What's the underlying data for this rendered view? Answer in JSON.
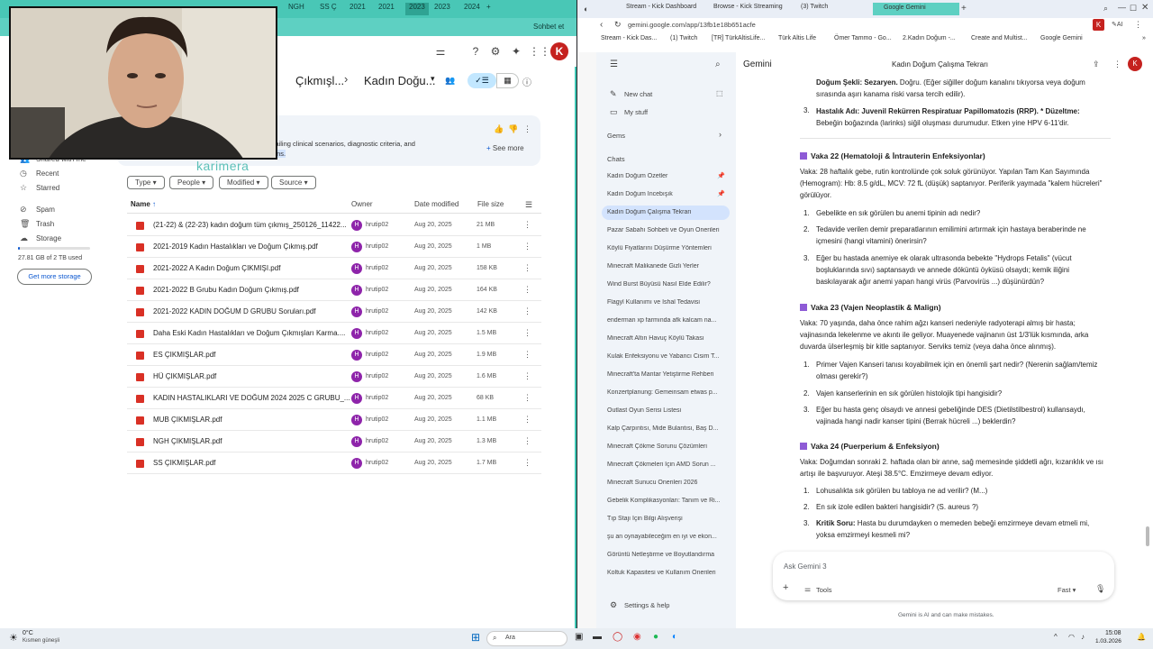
{
  "left_tabs": [
    "NGH",
    "SS Ç",
    "2021",
    "2021",
    "2023",
    "2023",
    "2024"
  ],
  "left_tab_extra": "Sohbet et",
  "drive": {
    "breadcrumb_1": "Çıkmışl...",
    "breadcrumb_2": "Kadın Doğu...",
    "brand_overlay": "karimera",
    "ai_summary_line1": "ns detailing clinical scenarios, diagnostic criteria, and",
    "ai_summary_line2": "onditions.",
    "see_more": "See more",
    "sidebar": {
      "shared": "Shared with me",
      "recent": "Recent",
      "starred": "Starred",
      "spam": "Spam",
      "trash": "Trash",
      "storage": "Storage",
      "storage_used": "27.81 GB of 2 TB used",
      "get_more": "Get more storage"
    },
    "filters": [
      "Type",
      "People",
      "Modified",
      "Source"
    ],
    "columns": {
      "name": "Name",
      "owner": "Owner",
      "date": "Date modified",
      "size": "File size"
    },
    "files": [
      {
        "name": "(21-22) & (22-23) kadın doğum tüm çıkmış_250126_11422...",
        "owner": "hrutip02",
        "date": "Aug 20, 2025",
        "size": "21 MB"
      },
      {
        "name": "2021-2019 Kadın Hastalıkları ve Doğum Çıkmış.pdf",
        "owner": "hrutip02",
        "date": "Aug 20, 2025",
        "size": "1 MB"
      },
      {
        "name": "2021-2022 A Kadın Doğum ÇIKMIŞI.pdf",
        "owner": "hrutip02",
        "date": "Aug 20, 2025",
        "size": "158 KB"
      },
      {
        "name": "2021-2022 B Grubu Kadın Doğum Çıkmış.pdf",
        "owner": "hrutip02",
        "date": "Aug 20, 2025",
        "size": "164 KB"
      },
      {
        "name": "2021-2022 KADIN DOĞUM D GRUBU Soruları.pdf",
        "owner": "hrutip02",
        "date": "Aug 20, 2025",
        "size": "142 KB"
      },
      {
        "name": "Daha Eski Kadın Hastalıkları ve Doğum Çıkmışları Karma....",
        "owner": "hrutip02",
        "date": "Aug 20, 2025",
        "size": "1.5 MB"
      },
      {
        "name": "ES ÇIKMIŞLAR.pdf",
        "owner": "hrutip02",
        "date": "Aug 20, 2025",
        "size": "1.9 MB"
      },
      {
        "name": "HÜ ÇIKMIŞLAR.pdf",
        "owner": "hrutip02",
        "date": "Aug 20, 2025",
        "size": "1.6 MB"
      },
      {
        "name": "KADIN HASTALIKLARI VE DOĞUM 2024 2025 C GRUBU_...",
        "owner": "hrutip02",
        "date": "Aug 20, 2025",
        "size": "68 KB"
      },
      {
        "name": "MUB ÇIKMIŞLAR.pdf",
        "owner": "hrutip02",
        "date": "Aug 20, 2025",
        "size": "1.1 MB"
      },
      {
        "name": "NGH ÇIKMIŞLAR.pdf",
        "owner": "hrutip02",
        "date": "Aug 20, 2025",
        "size": "1.3 MB"
      },
      {
        "name": "SS ÇIKMIŞLAR.pdf",
        "owner": "hrutip02",
        "date": "Aug 20, 2025",
        "size": "1.7 MB"
      }
    ]
  },
  "right_tabs": [
    "Stream - Kick Dashboard",
    "Browse - Kick Streaming",
    "(3) Twitch",
    "Google Gemini"
  ],
  "url": "gemini.google.com/app/13fb1e18b651acfe",
  "bookmarks": [
    "Stream - Kick Das...",
    "(1) Twitch",
    "[TR] TürkAltisLife...",
    "Türk Altis Life",
    "Ömer Tammo - Go...",
    "2.Kadın Doğum -...",
    "Create and Multist...",
    "Google Gemini"
  ],
  "gemini": {
    "brand": "Gemini",
    "chat_title": "Kadın Doğum Çalışma Tekrarı",
    "new_chat": "New chat",
    "my_stuff": "My stuff",
    "gems": "Gems",
    "chats_label": "Chats",
    "chats": [
      "Kadın Doğum Özetler",
      "Kadın Doğum İncebışık",
      "Kadın Doğum Çalışma Tekrarı",
      "Pazar Sabahı Sohbeti ve Oyun Önerileri",
      "Köylü Fiyatlarını Düşürme Yöntemleri",
      "Minecraft Malikanede Gizli Yerler",
      "Wind Burst Büyüsü Nasıl Elde Edilir?",
      "Flagyl Kullanımı ve İshal Tedavisi",
      "enderman xp farmında afk kalcam na...",
      "Minecraft Altın Havuç Köylü Takası",
      "Kulak Enfeksiyonu ve Yabancı Cisim T...",
      "Minecraft'ta Mantar Yetiştirme Rehberi",
      "Konzertplanung: Gemeinsam etwas p...",
      "Outlast Oyun Serisi Listesi",
      "Kalp Çarpıntısı, Mide Bulantısı, Baş D...",
      "Minecraft Çökme Sorunu Çözümleri",
      "Minecraft Çökmeleri İçin AMD Sorun ...",
      "Minecraft Sunucu Önerileri 2026",
      "Gebelik Komplikasyonları: Tanım ve Ri...",
      "Tıp Stajı İçin Bilgi Alışverişi",
      "şu an oynayabileceğim en iyi ve ekon...",
      "Görüntü Netleştirme ve Boyutlandırma",
      "Koltuk Kapasitesi ve Kullanım Önerileri"
    ],
    "settings": "Settings & help",
    "input_placeholder": "Ask Gemini 3",
    "tools": "Tools",
    "mode": "Fast",
    "disclaimer": "Gemini is AI and can make mistakes.",
    "texts": {
      "top1a": "Doğum Şekli: Sezaryen.",
      "top1b": " Doğru. (Eğer siğiller doğum kanalını tıkıyorsa veya doğum sırasında aşırı kanama riski varsa tercih edilir).",
      "top2n": "3.",
      "top2a": "Hastalık Adı: Juvenil Rekürren Respiratuar Papillomatozis (RRP). * Düzeltme:",
      "top2b": "Bebeğin boğazında (larinks) siğil oluşması durumudur. Etken yine HPV 6-11'dir.",
      "v22": "Vaka 22 (Hematoloji & İntrauterin Enfeksiyonlar)",
      "v22p": "Vaka: 28 haftalık gebe, rutin kontrolünde çok soluk görünüyor. Yapılan Tam Kan Sayımında (Hemogram): Hb: 8.5 g/dL, MCV: 72 fL (düşük) saptanıyor. Periferik yaymada \"kalem hücreleri\" görülüyor.",
      "v22q1": "Gebelikte en sık görülen bu anemi tipinin adı nedir?",
      "v22q2": "Tedavide verilen demir preparatlarının emilimini artırmak için hastaya beraberinde ne içmesini (hangi vitamini) önerirsin?",
      "v22q3": "Eğer bu hastada anemiye ek olarak ultrasonda bebekte \"Hydrops Fetalis\" (vücut boşluklarında sıvı) saptansaydı ve annede döküntü öyküsü olsaydı; kemik iliğini baskılayarak ağır anemi yapan hangi virüs (Parvovirüs ...) düşünürdün?",
      "v23": "Vaka 23 (Vajen Neoplastik & Malign)",
      "v23p": "Vaka: 70 yaşında, daha önce rahim ağzı kanseri nedeniyle radyoterapi almış bir hasta; vajinasında lekelenme ve akıntı ile geliyor. Muayenede vajinanın üst 1/3'lük kısmında, arka duvarda ülserleşmiş bir kitle saptanıyor. Serviks temiz (veya daha önce alınmış).",
      "v23q1": "Primer Vajen Kanseri tanısı koyabilmek için en önemli şart nedir? (Nerenin sağlam/temiz olması gerekir?)",
      "v23q2": "Vajen kanserlerinin en sık görülen histolojik tipi hangisidir?",
      "v23q3": "Eğer bu hasta genç olsaydı ve annesi gebeliğinde DES (Dietilstilbestrol) kullansaydı, vajinada hangi nadir kanser tipini (Berrak hücreli ...) beklerdin?",
      "v24": "Vaka 24 (Puerperium & Enfeksiyon)",
      "v24p": "Vaka: Doğumdan sonraki 2. haftada olan bir anne, sağ memesinde şiddetli ağrı, kızarıklık ve ısı artışı ile başvuruyor. Ateşi 38.5°C. Emzirmeye devam ediyor.",
      "v24q1": "Lohusalıkta sık görülen bu tabloya ne ad verilir? (M...)",
      "v24q2": "En sık izole edilen bakteri hangisidir? (S. aureus ?)",
      "v24q3a": "Kritik Soru:",
      "v24q3b": " Hasta bu durumdayken o memeden bebeği emzirmeye devam etmeli mi, yoksa emzirmeyi kesmeli mi?"
    }
  },
  "taskbar": {
    "temp": "0°C",
    "weather": "Kısmen güneşli",
    "search": "Ara",
    "time": "15:08",
    "date": "1.03.2026"
  },
  "avatar_letter": "K"
}
